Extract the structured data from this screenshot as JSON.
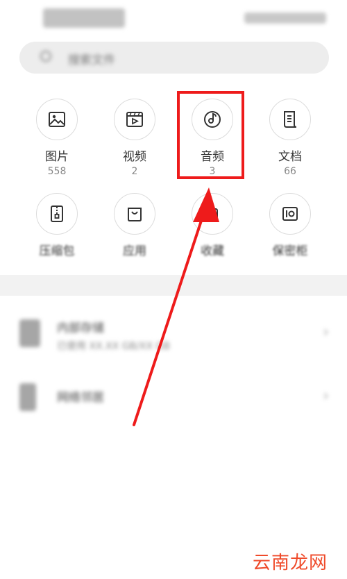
{
  "status_bar": {
    "time": "",
    "icons": ""
  },
  "search": {
    "placeholder": "搜索文件",
    "icon": "search-icon"
  },
  "categories": [
    {
      "label": "图片",
      "count": "558",
      "icon": "image-icon"
    },
    {
      "label": "视频",
      "count": "2",
      "icon": "video-icon"
    },
    {
      "label": "音频",
      "count": "3",
      "icon": "audio-icon"
    },
    {
      "label": "文档",
      "count": "66",
      "icon": "document-icon"
    },
    {
      "label": "压缩包",
      "count": "",
      "icon": "zip-icon"
    },
    {
      "label": "应用",
      "count": "",
      "icon": "shopping-bag-icon"
    },
    {
      "label": "收藏",
      "count": "",
      "icon": "star-icon"
    },
    {
      "label": "保密柜",
      "count": "",
      "icon": "safe-icon"
    }
  ],
  "storage": [
    {
      "title": "内部存储",
      "subtitle": "已使用 XX.XX GB/XX GB",
      "icon": "phone-storage-icon"
    },
    {
      "title": "网络邻居",
      "subtitle": "",
      "icon": "network-icon"
    }
  ],
  "annotation": {
    "highlight_color": "#ee1b1b",
    "highlighted_item": "音频"
  },
  "watermark": "云南龙网"
}
